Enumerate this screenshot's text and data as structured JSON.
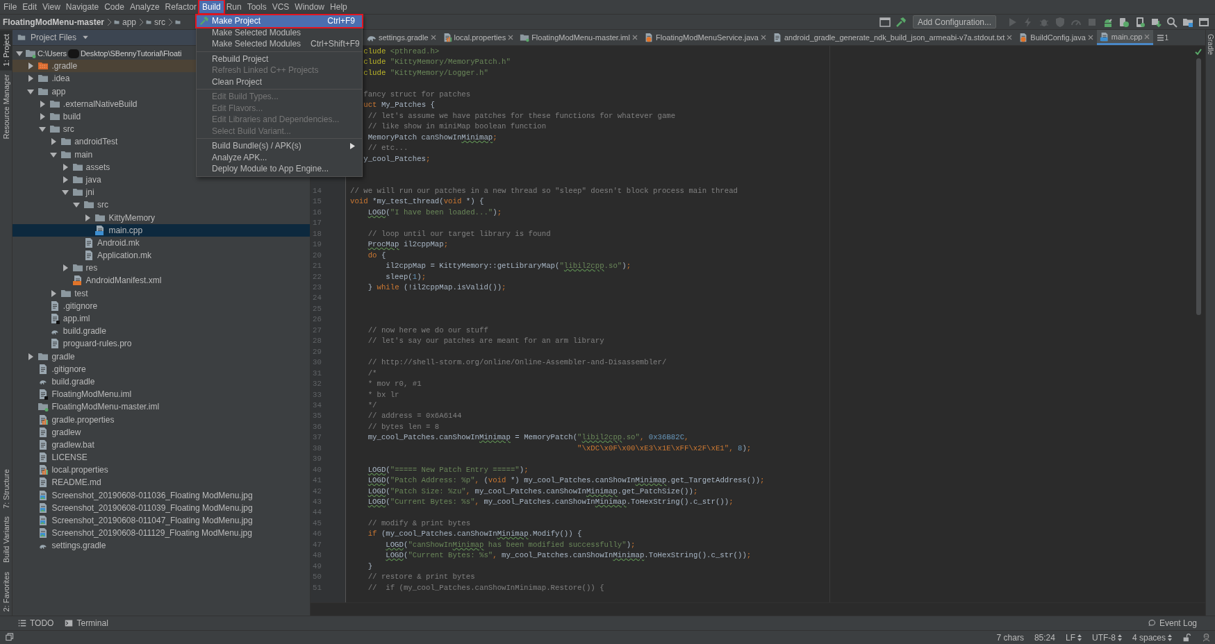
{
  "menu_bar": [
    {
      "label": "File",
      "selected": false,
      "annotated": false
    },
    {
      "label": "Edit",
      "selected": false,
      "annotated": false
    },
    {
      "label": "View",
      "selected": false,
      "annotated": false
    },
    {
      "label": "Navigate",
      "selected": false,
      "annotated": false
    },
    {
      "label": "Code",
      "selected": false,
      "annotated": false
    },
    {
      "label": "Analyze",
      "selected": false,
      "annotated": false
    },
    {
      "label": "Refactor",
      "selected": false,
      "annotated": false
    },
    {
      "label": "Build",
      "selected": true,
      "annotated": true
    },
    {
      "label": "Run",
      "selected": false,
      "annotated": false
    },
    {
      "label": "Tools",
      "selected": false,
      "annotated": false
    },
    {
      "label": "VCS",
      "selected": false,
      "annotated": false
    },
    {
      "label": "Window",
      "selected": false,
      "annotated": false
    },
    {
      "label": "Help",
      "selected": false,
      "annotated": false
    }
  ],
  "build_menu": [
    {
      "kind": "item",
      "label": "Make Project",
      "shortcut": "Ctrl+F9",
      "selected": true,
      "disabled": false,
      "annotated": true
    },
    {
      "kind": "item",
      "label": "Make Selected Modules",
      "selected": false,
      "disabled": false,
      "annotated": false
    },
    {
      "kind": "item",
      "label": "Make Selected Modules",
      "shortcut": "Ctrl+Shift+F9",
      "selected": false,
      "disabled": false,
      "annotated": false
    },
    {
      "kind": "separator"
    },
    {
      "kind": "item",
      "label": "Rebuild Project",
      "selected": false,
      "disabled": false,
      "annotated": false
    },
    {
      "kind": "item",
      "label": "Refresh Linked C++ Projects",
      "selected": false,
      "disabled": true,
      "annotated": false
    },
    {
      "kind": "item",
      "label": "Clean Project",
      "selected": false,
      "disabled": false,
      "annotated": false
    },
    {
      "kind": "separator"
    },
    {
      "kind": "item",
      "label": "Edit Build Types...",
      "selected": false,
      "disabled": true,
      "annotated": false
    },
    {
      "kind": "item",
      "label": "Edit Flavors...",
      "selected": false,
      "disabled": true,
      "annotated": false
    },
    {
      "kind": "item",
      "label": "Edit Libraries and Dependencies...",
      "selected": false,
      "disabled": true,
      "annotated": false
    },
    {
      "kind": "item",
      "label": "Select Build Variant...",
      "selected": false,
      "disabled": true,
      "annotated": false
    },
    {
      "kind": "separator"
    },
    {
      "kind": "submenu",
      "label": "Build Bundle(s) / APK(s)",
      "selected": false,
      "disabled": false,
      "annotated": false
    },
    {
      "kind": "item",
      "label": "Analyze APK...",
      "selected": false,
      "disabled": false,
      "annotated": false
    },
    {
      "kind": "item",
      "label": "Deploy Module to App Engine...",
      "selected": false,
      "disabled": false,
      "annotated": false
    }
  ],
  "breadcrumb": [
    "FloatingModMenu-master",
    "app",
    "src"
  ],
  "toolbar": {
    "configuration": "Add Configuration..."
  },
  "left_tool_buttons": {
    "top": [
      {
        "label": "1: Project",
        "selected": true
      },
      {
        "label": "Resource Manager",
        "selected": false
      }
    ],
    "bottom": [
      {
        "label": "7: Structure",
        "selected": false
      },
      {
        "label": "Build Variants",
        "selected": false
      },
      {
        "label": "2: Favorites",
        "selected": false
      }
    ]
  },
  "right_tool_buttons": [
    {
      "label": "Gradle",
      "selected": false
    }
  ],
  "project_panel": {
    "title": "Project Files",
    "tree": [
      {
        "label_parts": [
          "C:\\Users",
          "Desktop\\SBennyTutorial\\Floati"
        ],
        "kind": "module",
        "expanded": true,
        "selected": false,
        "ignored": false,
        "children": [
          {
            "label": ".gradle",
            "kind": "excluded-folder",
            "expanded": false,
            "selected": false,
            "ignored": true
          },
          {
            "label": ".idea",
            "kind": "folder",
            "expanded": false,
            "selected": false,
            "ignored": false
          },
          {
            "label": "app",
            "kind": "folder",
            "expanded": true,
            "selected": false,
            "ignored": false,
            "children": [
              {
                "label": ".externalNativeBuild",
                "kind": "folder",
                "expanded": false,
                "selected": false,
                "ignored": false
              },
              {
                "label": "build",
                "kind": "folder",
                "expanded": false,
                "selected": false,
                "ignored": false
              },
              {
                "label": "src",
                "kind": "folder",
                "expanded": true,
                "selected": false,
                "ignored": false,
                "children": [
                  {
                    "label": "androidTest",
                    "kind": "folder",
                    "expanded": false,
                    "selected": false,
                    "ignored": false
                  },
                  {
                    "label": "main",
                    "kind": "folder",
                    "expanded": true,
                    "selected": false,
                    "ignored": false,
                    "children": [
                      {
                        "label": "assets",
                        "kind": "folder",
                        "expanded": false,
                        "selected": false,
                        "ignored": false
                      },
                      {
                        "label": "java",
                        "kind": "folder",
                        "expanded": false,
                        "selected": false,
                        "ignored": false
                      },
                      {
                        "label": "jni",
                        "kind": "folder",
                        "expanded": true,
                        "selected": false,
                        "ignored": false,
                        "children": [
                          {
                            "label": "src",
                            "kind": "folder",
                            "expanded": true,
                            "selected": false,
                            "ignored": false,
                            "children": [
                              {
                                "label": "KittyMemory",
                                "kind": "folder",
                                "expanded": false,
                                "selected": false,
                                "ignored": false
                              },
                              {
                                "label": "main.cpp",
                                "kind": "cpp",
                                "selected": true,
                                "ignored": false
                              }
                            ]
                          },
                          {
                            "label": "Android.mk",
                            "kind": "text",
                            "selected": false,
                            "ignored": false
                          },
                          {
                            "label": "Application.mk",
                            "kind": "text",
                            "selected": false,
                            "ignored": false
                          }
                        ]
                      },
                      {
                        "label": "res",
                        "kind": "folder",
                        "expanded": false,
                        "selected": false,
                        "ignored": false
                      },
                      {
                        "label": "AndroidManifest.xml",
                        "kind": "xml",
                        "selected": false,
                        "ignored": false
                      }
                    ]
                  },
                  {
                    "label": "test",
                    "kind": "folder",
                    "expanded": false,
                    "selected": false,
                    "ignored": false
                  }
                ]
              },
              {
                "label": ".gitignore",
                "kind": "text",
                "selected": false,
                "ignored": false
              },
              {
                "label": "app.iml",
                "kind": "iml",
                "selected": false,
                "ignored": false
              },
              {
                "label": "build.gradle",
                "kind": "gradle",
                "selected": false,
                "ignored": false
              },
              {
                "label": "proguard-rules.pro",
                "kind": "text",
                "selected": false,
                "ignored": false
              }
            ]
          },
          {
            "label": "gradle",
            "kind": "folder",
            "expanded": false,
            "selected": false,
            "ignored": false
          },
          {
            "label": ".gitignore",
            "kind": "text",
            "selected": false,
            "ignored": false
          },
          {
            "label": "build.gradle",
            "kind": "gradle",
            "selected": false,
            "ignored": false
          },
          {
            "label": "FloatingModMenu.iml",
            "kind": "iml",
            "selected": false,
            "ignored": false
          },
          {
            "label": "FloatingModMenu-master.iml",
            "kind": "module-iml",
            "selected": false,
            "ignored": false
          },
          {
            "label": "gradle.properties",
            "kind": "properties",
            "selected": false,
            "ignored": false
          },
          {
            "label": "gradlew",
            "kind": "text",
            "selected": false,
            "ignored": false
          },
          {
            "label": "gradlew.bat",
            "kind": "text",
            "selected": false,
            "ignored": false
          },
          {
            "label": "LICENSE",
            "kind": "text",
            "selected": false,
            "ignored": false
          },
          {
            "label": "local.properties",
            "kind": "properties",
            "selected": false,
            "ignored": false
          },
          {
            "label": "README.md",
            "kind": "text",
            "selected": false,
            "ignored": false
          },
          {
            "label": "Screenshot_20190608-011036_Floating ModMenu.jpg",
            "kind": "image",
            "selected": false,
            "ignored": false
          },
          {
            "label": "Screenshot_20190608-011039_Floating ModMenu.jpg",
            "kind": "image",
            "selected": false,
            "ignored": false
          },
          {
            "label": "Screenshot_20190608-011047_Floating ModMenu.jpg",
            "kind": "image",
            "selected": false,
            "ignored": false
          },
          {
            "label": "Screenshot_20190608-011129_Floating ModMenu.jpg",
            "kind": "image",
            "selected": false,
            "ignored": false
          },
          {
            "label": "settings.gradle",
            "kind": "gradle",
            "selected": false,
            "ignored": false
          }
        ]
      }
    ]
  },
  "editor_tabs": {
    "tabs": [
      {
        "label": "settings.gradle",
        "kind": "gradle",
        "selected": false
      },
      {
        "label": "local.properties",
        "kind": "properties",
        "selected": false
      },
      {
        "label": "FloatingModMenu-master.iml",
        "kind": "module-iml",
        "selected": false
      },
      {
        "label": "FloatingModMenuService.java",
        "kind": "java",
        "selected": false
      },
      {
        "label": "android_gradle_generate_ndk_build_json_armeabi-v7a.stdout.txt",
        "kind": "text",
        "selected": false
      },
      {
        "label": "BuildConfig.java",
        "kind": "java",
        "selected": false
      },
      {
        "label": "main.cpp",
        "kind": "cpp",
        "selected": true
      }
    ],
    "hidden_count": "1"
  },
  "code": [
    {
      "kind": "code",
      "segs": [
        {
          "kind": "directive",
          "text": "   clude"
        },
        {
          "kind": "string",
          "text": " <pthread.h>"
        }
      ]
    },
    {
      "kind": "code",
      "segs": [
        {
          "kind": "directive",
          "text": "   clude"
        },
        {
          "kind": "string",
          "text": " \"KittyMemory/MemoryPatch.h\""
        }
      ]
    },
    {
      "kind": "code",
      "segs": [
        {
          "kind": "directive",
          "text": "   clude"
        },
        {
          "kind": "string",
          "text": " \"KittyMemory/Logger.h\""
        }
      ]
    },
    {
      "kind": "blank"
    },
    {
      "kind": "code",
      "segs": [
        {
          "kind": "comment",
          "text": "   fancy struct for patches"
        }
      ]
    },
    {
      "kind": "code",
      "segs": [
        {
          "kind": "keyword",
          "text": "   uct"
        },
        {
          "kind": "plain",
          "text": " My_Patches {"
        }
      ]
    },
    {
      "kind": "code",
      "segs": [
        {
          "kind": "comment",
          "text": "    // let's assume we have patches for these functions for whatever game"
        }
      ]
    },
    {
      "kind": "code",
      "segs": [
        {
          "kind": "comment",
          "text": "    // like show in miniMap boolean function"
        }
      ]
    },
    {
      "kind": "code",
      "segs": [
        {
          "kind": "plain",
          "text": "    MemoryPatch canShowIn"
        },
        {
          "kind": "typo",
          "text": "Minimap"
        },
        {
          "kind": "keyword",
          "text": ";"
        }
      ]
    },
    {
      "kind": "code",
      "segs": [
        {
          "kind": "comment",
          "text": "    // etc..."
        }
      ]
    },
    {
      "kind": "code",
      "segs": [
        {
          "kind": "plain",
          "text": "   y_cool_Patches"
        },
        {
          "kind": "keyword",
          "text": ";"
        }
      ]
    },
    {
      "kind": "blank"
    },
    {
      "kind": "blank"
    },
    {
      "kind": "code",
      "n": "14",
      "segs": [
        {
          "kind": "comment",
          "text": "// we will run our patches in a new thread so \"sleep\" doesn't block process main thread"
        }
      ]
    },
    {
      "kind": "code",
      "n": "15",
      "segs": [
        {
          "kind": "keyword",
          "text": "void"
        },
        {
          "kind": "plain",
          "text": " *my_test_thread("
        },
        {
          "kind": "keyword",
          "text": "void"
        },
        {
          "kind": "plain",
          "text": " *) {"
        }
      ]
    },
    {
      "kind": "code",
      "n": "16",
      "segs": [
        {
          "kind": "typo",
          "text": "    LOGD"
        },
        {
          "kind": "plain",
          "text": "("
        },
        {
          "kind": "string",
          "text": "\"I have been loaded...\""
        },
        {
          "kind": "plain",
          "text": ")"
        },
        {
          "kind": "keyword",
          "text": ";"
        }
      ]
    },
    {
      "kind": "blank",
      "n": "17"
    },
    {
      "kind": "code",
      "n": "18",
      "segs": [
        {
          "kind": "comment",
          "text": "    // loop until our target library is found"
        }
      ]
    },
    {
      "kind": "code",
      "n": "19",
      "segs": [
        {
          "kind": "typo",
          "text": "    ProcMap"
        },
        {
          "kind": "plain",
          "text": " il2cppMap"
        },
        {
          "kind": "keyword",
          "text": ";"
        }
      ]
    },
    {
      "kind": "code",
      "n": "20",
      "segs": [
        {
          "kind": "keyword",
          "text": "    do"
        },
        {
          "kind": "plain",
          "text": " {"
        }
      ]
    },
    {
      "kind": "code",
      "n": "21",
      "segs": [
        {
          "kind": "plain",
          "text": "        il2cppMap = KittyMemory::getLibraryMap("
        },
        {
          "kind": "string",
          "text": "\""
        },
        {
          "kind": "string-typo",
          "text": "libil2cpp"
        },
        {
          "kind": "string",
          "text": ".so\""
        },
        {
          "kind": "plain",
          "text": ")"
        },
        {
          "kind": "keyword",
          "text": ";"
        }
      ]
    },
    {
      "kind": "code",
      "n": "22",
      "segs": [
        {
          "kind": "plain",
          "text": "        sleep("
        },
        {
          "kind": "number",
          "text": "1"
        },
        {
          "kind": "plain",
          "text": ")"
        },
        {
          "kind": "keyword",
          "text": ";"
        }
      ]
    },
    {
      "kind": "code",
      "n": "23",
      "segs": [
        {
          "kind": "plain",
          "text": "    }"
        },
        {
          "kind": "keyword",
          "text": " while"
        },
        {
          "kind": "plain",
          "text": " (!il2cppMap.isValid())"
        },
        {
          "kind": "keyword",
          "text": ";"
        }
      ]
    },
    {
      "kind": "blank",
      "n": "24"
    },
    {
      "kind": "blank",
      "n": "25"
    },
    {
      "kind": "blank",
      "n": "26"
    },
    {
      "kind": "code",
      "n": "27",
      "segs": [
        {
          "kind": "comment",
          "text": "    // now here we do our stuff"
        }
      ]
    },
    {
      "kind": "code",
      "n": "28",
      "segs": [
        {
          "kind": "comment",
          "text": "    // let's say our patches are meant for an arm library"
        }
      ]
    },
    {
      "kind": "blank",
      "n": "29"
    },
    {
      "kind": "code",
      "n": "30",
      "segs": [
        {
          "kind": "comment",
          "text": "    // http://shell-storm.org/online/Online-Assembler-and-Disassembler/"
        }
      ]
    },
    {
      "kind": "code",
      "n": "31",
      "segs": [
        {
          "kind": "comment",
          "text": "    /*"
        }
      ]
    },
    {
      "kind": "code",
      "n": "32",
      "segs": [
        {
          "kind": "comment",
          "text": "    * mov r0, #1"
        }
      ]
    },
    {
      "kind": "code",
      "n": "33",
      "segs": [
        {
          "kind": "comment",
          "text": "    * bx lr"
        }
      ]
    },
    {
      "kind": "code",
      "n": "34",
      "segs": [
        {
          "kind": "comment",
          "text": "    */"
        }
      ]
    },
    {
      "kind": "code",
      "n": "35",
      "segs": [
        {
          "kind": "comment",
          "text": "    // address = 0x6A6144"
        }
      ]
    },
    {
      "kind": "code",
      "n": "36",
      "segs": [
        {
          "kind": "comment",
          "text": "    // bytes len = 8"
        }
      ]
    },
    {
      "kind": "code",
      "n": "37",
      "segs": [
        {
          "kind": "plain",
          "text": "    my_cool_Patches.canShowIn"
        },
        {
          "kind": "typo",
          "text": "Minimap"
        },
        {
          "kind": "plain",
          "text": " = MemoryPatch("
        },
        {
          "kind": "string",
          "text": "\""
        },
        {
          "kind": "string-typo",
          "text": "libil2cpp"
        },
        {
          "kind": "string",
          "text": ".so\""
        },
        {
          "kind": "keyword",
          "text": ","
        },
        {
          "kind": "number",
          "text": " 0x36B82C"
        },
        {
          "kind": "keyword",
          "text": ","
        }
      ]
    },
    {
      "kind": "code",
      "n": "38",
      "segs": [
        {
          "kind": "escape",
          "text": "                                                   \"\\xDC\\x0F\\x00\\xE3\\x1E\\xFF\\x2F\\xE1\""
        },
        {
          "kind": "keyword",
          "text": ","
        },
        {
          "kind": "number",
          "text": " 8"
        },
        {
          "kind": "plain",
          "text": ")"
        },
        {
          "kind": "keyword",
          "text": ";"
        }
      ]
    },
    {
      "kind": "blank",
      "n": "39"
    },
    {
      "kind": "code",
      "n": "40",
      "segs": [
        {
          "kind": "typo",
          "text": "    LOGD"
        },
        {
          "kind": "plain",
          "text": "("
        },
        {
          "kind": "string",
          "text": "\"===== New Patch Entry =====\""
        },
        {
          "kind": "plain",
          "text": ")"
        },
        {
          "kind": "keyword",
          "text": ";"
        }
      ]
    },
    {
      "kind": "code",
      "n": "41",
      "segs": [
        {
          "kind": "typo",
          "text": "    LOGD"
        },
        {
          "kind": "plain",
          "text": "("
        },
        {
          "kind": "string",
          "text": "\"Patch Address: %p\""
        },
        {
          "kind": "keyword",
          "text": ","
        },
        {
          "kind": "plain",
          "text": " ("
        },
        {
          "kind": "keyword",
          "text": "void"
        },
        {
          "kind": "plain",
          "text": " *) my_cool_Patches.canShowIn"
        },
        {
          "kind": "typo",
          "text": "Minimap"
        },
        {
          "kind": "plain",
          "text": ".get_TargetAddress())"
        },
        {
          "kind": "keyword",
          "text": ";"
        }
      ]
    },
    {
      "kind": "code",
      "n": "42",
      "segs": [
        {
          "kind": "typo",
          "text": "    LOGD"
        },
        {
          "kind": "plain",
          "text": "("
        },
        {
          "kind": "string",
          "text": "\"Patch Size: %zu\""
        },
        {
          "kind": "keyword",
          "text": ","
        },
        {
          "kind": "plain",
          "text": " my_cool_Patches.canShowIn"
        },
        {
          "kind": "typo",
          "text": "Minimap"
        },
        {
          "kind": "plain",
          "text": ".get_PatchSize())"
        },
        {
          "kind": "keyword",
          "text": ";"
        }
      ]
    },
    {
      "kind": "code",
      "n": "43",
      "segs": [
        {
          "kind": "typo",
          "text": "    LOGD"
        },
        {
          "kind": "plain",
          "text": "("
        },
        {
          "kind": "string",
          "text": "\"Current Bytes: %s\""
        },
        {
          "kind": "keyword",
          "text": ","
        },
        {
          "kind": "plain",
          "text": " my_cool_Patches.canShowIn"
        },
        {
          "kind": "typo",
          "text": "Minimap"
        },
        {
          "kind": "plain",
          "text": ".ToHexString().c_str())"
        },
        {
          "kind": "keyword",
          "text": ";"
        }
      ]
    },
    {
      "kind": "blank",
      "n": "44"
    },
    {
      "kind": "code",
      "n": "45",
      "segs": [
        {
          "kind": "comment",
          "text": "    // modify & print bytes"
        }
      ]
    },
    {
      "kind": "code",
      "n": "46",
      "segs": [
        {
          "kind": "keyword",
          "text": "    if"
        },
        {
          "kind": "plain",
          "text": " (my_cool_Patches.canShowIn"
        },
        {
          "kind": "typo",
          "text": "Minimap"
        },
        {
          "kind": "plain",
          "text": ".Modify()) {"
        }
      ]
    },
    {
      "kind": "code",
      "n": "47",
      "segs": [
        {
          "kind": "typo",
          "text": "        LOGD"
        },
        {
          "kind": "plain",
          "text": "("
        },
        {
          "kind": "string",
          "text": "\"canShowIn"
        },
        {
          "kind": "string-typo",
          "text": "Minimap"
        },
        {
          "kind": "string",
          "text": " has been modified successfully\""
        },
        {
          "kind": "plain",
          "text": ")"
        },
        {
          "kind": "keyword",
          "text": ";"
        }
      ]
    },
    {
      "kind": "code",
      "n": "48",
      "segs": [
        {
          "kind": "typo",
          "text": "        LOGD"
        },
        {
          "kind": "plain",
          "text": "("
        },
        {
          "kind": "string",
          "text": "\"Current Bytes: %s\""
        },
        {
          "kind": "keyword",
          "text": ","
        },
        {
          "kind": "plain",
          "text": " my_cool_Patches.canShowIn"
        },
        {
          "kind": "typo",
          "text": "Minimap"
        },
        {
          "kind": "plain",
          "text": ".ToHexString().c_str())"
        },
        {
          "kind": "keyword",
          "text": ";"
        }
      ]
    },
    {
      "kind": "code",
      "n": "49",
      "segs": [
        {
          "kind": "plain",
          "text": "    }"
        }
      ]
    },
    {
      "kind": "code",
      "n": "50",
      "segs": [
        {
          "kind": "comment",
          "text": "    // restore & print bytes"
        }
      ]
    },
    {
      "kind": "code",
      "n": "51",
      "segs": [
        {
          "kind": "comment",
          "text": "    //  if (my_cool_Patches.canShowInMinimap.Restore()) {"
        }
      ]
    }
  ],
  "bottom_tool_buttons": [
    {
      "label": "TODO",
      "kind": "todo"
    },
    {
      "label": "Terminal",
      "kind": "terminal"
    }
  ],
  "event_log": "Event Log",
  "status_bar": {
    "selection": "7 chars",
    "position": "85:24",
    "line_separator": "LF",
    "encoding": "UTF-8",
    "indent": "4 spaces"
  }
}
